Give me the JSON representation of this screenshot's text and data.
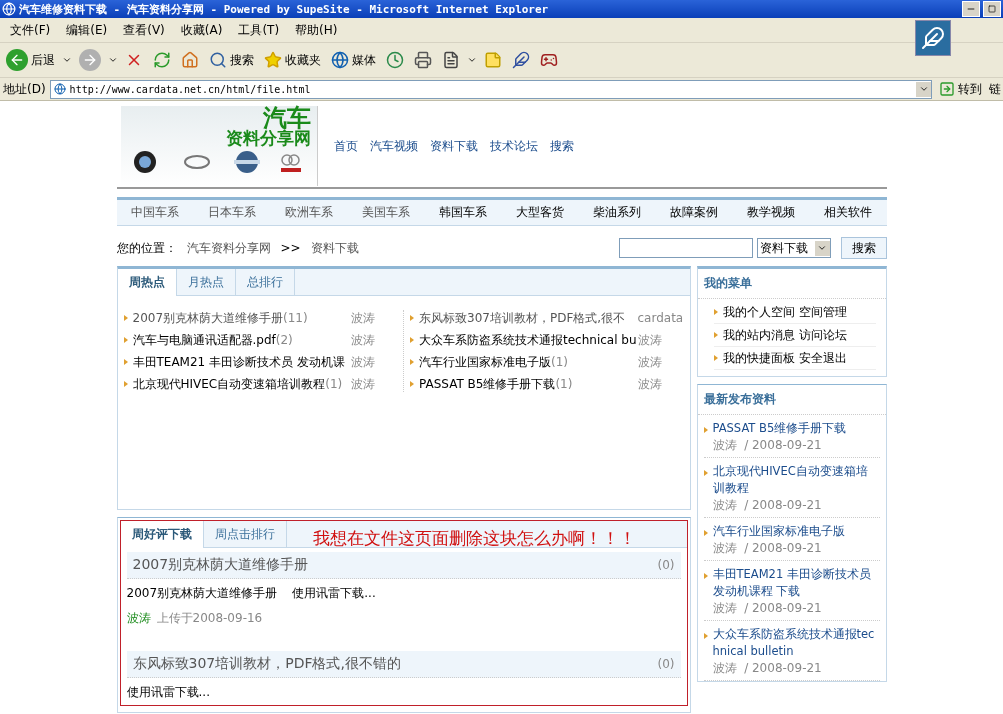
{
  "window": {
    "title": "汽车维修资料下载 - 汽车资料分享网 - Powered by SupeSite - Microsoft Internet Explorer"
  },
  "menu": [
    "文件(F)",
    "编辑(E)",
    "查看(V)",
    "收藏(A)",
    "工具(T)",
    "帮助(H)"
  ],
  "toolbar": [
    {
      "kind": "back",
      "label": "后退",
      "dropdown": true
    },
    {
      "kind": "forward",
      "dropdown": true
    },
    {
      "kind": "stop"
    },
    {
      "kind": "refresh"
    },
    {
      "kind": "home"
    },
    {
      "kind": "search",
      "label": "搜索"
    },
    {
      "kind": "favorites",
      "label": "收藏夹"
    },
    {
      "kind": "media",
      "label": "媒体"
    },
    {
      "kind": "history"
    },
    {
      "kind": "print"
    },
    {
      "kind": "edit",
      "dropdown": true
    },
    {
      "kind": "note"
    },
    {
      "kind": "messenger"
    },
    {
      "kind": "game"
    }
  ],
  "address": {
    "label": "地址(D)",
    "url": "http://www.cardata.net.cn/html/file.html",
    "go": "转到",
    "links": "链"
  },
  "header": {
    "logo": [
      "汽车",
      "资料分享网"
    ],
    "nav": [
      "首页",
      "汽车视频",
      "资料下载",
      "技术论坛",
      "搜索"
    ]
  },
  "categories": [
    {
      "label": "中国车系",
      "visited": true
    },
    {
      "label": "日本车系",
      "visited": true
    },
    {
      "label": "欧洲车系",
      "visited": true
    },
    {
      "label": "美国车系",
      "visited": true
    },
    {
      "label": "韩国车系",
      "visited": false
    },
    {
      "label": "大型客货",
      "visited": false
    },
    {
      "label": "柴油系列",
      "visited": false
    },
    {
      "label": "故障案例",
      "visited": false
    },
    {
      "label": "教学视频",
      "visited": false
    },
    {
      "label": "相关软件",
      "visited": false
    }
  ],
  "breadcrumb": {
    "label": "您的位置：",
    "items": [
      "汽车资料分享网",
      "资料下载"
    ],
    "separator": ">>"
  },
  "search": {
    "select": "资料下载",
    "button": "搜索"
  },
  "hot": {
    "tabs": [
      {
        "label": "周热点",
        "selected": true
      },
      {
        "label": "月热点",
        "selected": false
      },
      {
        "label": "总排行",
        "selected": false
      }
    ],
    "columns": [
      [
        {
          "title": "2007别克林荫大道维修手册",
          "count": "(11)",
          "author": "波涛",
          "visited": true
        },
        {
          "title": "汽车与电脑通讯适配器.pdf",
          "count": "(2)",
          "author": "波涛",
          "visited": false
        },
        {
          "title": "丰田TEAM21 丰田诊断技术员  发动机课",
          "author": "波涛",
          "visited": false
        },
        {
          "title": "北京现代HIVEC自动变速箱培训教程",
          "count": "(1)",
          "author": "波涛",
          "visited": false
        }
      ],
      [
        {
          "title": "东风标致307培训教材，PDF格式,很不",
          "author": "cardata",
          "visited": true
        },
        {
          "title": "大众车系防盗系统技术通报technical bu",
          "author": "波涛",
          "visited": false
        },
        {
          "title": "汽车行业国家标准电子版",
          "count": "(1)",
          "author": "波涛",
          "visited": false
        },
        {
          "title": "PASSAT B5维修手册下载",
          "count": "(1)",
          "author": "波涛",
          "visited": false
        }
      ]
    ]
  },
  "downloads": {
    "tabs": [
      {
        "label": "周好评下载",
        "selected": true
      },
      {
        "label": "周点击排行",
        "selected": false
      }
    ],
    "annotation": "我想在文件这页面删除这块怎么办啊！！！",
    "items": [
      {
        "title": "2007别克林荫大道维修手册",
        "count": "(0)",
        "description": "2007别克林荫大道维修手册    使用讯雷下载...",
        "author": "波涛",
        "uploaded": "上传于2008-09-16"
      },
      {
        "title": "东风标致307培训教材，PDF格式,很不错的",
        "count": "(0)",
        "description": "使用讯雷下载..."
      }
    ]
  },
  "my_menu": {
    "title": "我的菜单",
    "rows": [
      [
        "我的个人空间",
        "空间管理"
      ],
      [
        "我的站内消息",
        "访问论坛"
      ],
      [
        "我的快捷面板",
        "安全退出"
      ]
    ]
  },
  "latest": {
    "title": "最新发布资料",
    "items": [
      {
        "title": "PASSAT B5维修手册下载",
        "meta": "波涛  / 2008-09-21"
      },
      {
        "title": "北京现代HIVEC自动变速箱培训教程",
        "meta": "波涛  / 2008-09-21"
      },
      {
        "title": "汽车行业国家标准电子版",
        "meta": "波涛  / 2008-09-21"
      },
      {
        "title": "丰田TEAM21 丰田诊断技术员发动机课程  下载",
        "meta": "波涛  / 2008-09-21"
      },
      {
        "title": "大众车系防盗系统技术通报technical bulletin",
        "meta": "波涛  / 2008-09-21"
      }
    ]
  }
}
